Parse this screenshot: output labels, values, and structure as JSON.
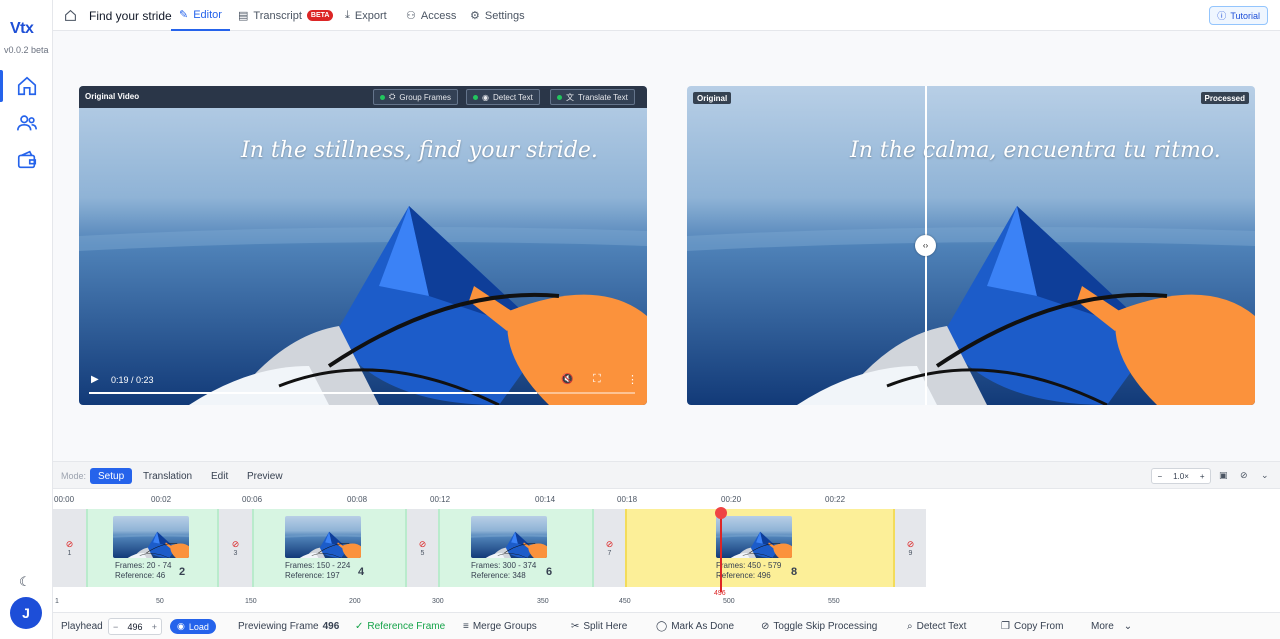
{
  "app": {
    "logo": "Vtx",
    "version": "v0.0.2 beta",
    "user_initial": "J"
  },
  "nav": {
    "project_title": "Find your stride",
    "tabs": [
      {
        "label": "Editor"
      },
      {
        "label": "Transcript"
      },
      {
        "label": "Export"
      },
      {
        "label": "Access"
      },
      {
        "label": "Settings"
      }
    ],
    "beta_badge": "BETA",
    "tutorial_label": "Tutorial"
  },
  "original_video": {
    "title": "Original Video",
    "buttons": [
      "Group Frames",
      "Detect Text",
      "Translate Text"
    ],
    "caption": "In the stillness, find your stride.",
    "time": "0:19 / 0:23",
    "progress": 0.82
  },
  "compare": {
    "left_label": "Original",
    "right_label": "Processed",
    "caption": "In the calma, encuentra tu ritmo."
  },
  "modebar": {
    "label": "Mode:",
    "tabs": [
      "Setup",
      "Translation",
      "Edit",
      "Preview"
    ],
    "zoom": "1.0×",
    "zoom_minus": "−",
    "zoom_plus": "+"
  },
  "timeline": {
    "time_labels": [
      "00:00",
      "00:02",
      "00:06",
      "00:08",
      "00:12",
      "00:14",
      "00:18",
      "00:20",
      "00:22"
    ],
    "skip_markers": [
      "1",
      "3",
      "5",
      "7",
      "9"
    ],
    "segments": [
      {
        "frames": "Frames: 20 - 74",
        "reference": "Reference: 46",
        "num": "2"
      },
      {
        "frames": "Frames: 150 - 224",
        "reference": "Reference: 197",
        "num": "4"
      },
      {
        "frames": "Frames: 300 - 374",
        "reference": "Reference: 348",
        "num": "6"
      },
      {
        "frames": "Frames: 450 - 579",
        "reference": "Reference: 496",
        "num": "8"
      }
    ],
    "frame_labels": [
      "1",
      "50",
      "150",
      "200",
      "300",
      "350",
      "450",
      "500",
      "550"
    ],
    "playhead_frame": "496"
  },
  "toolbar": {
    "playhead_label": "Playhead",
    "playhead_value": "496",
    "minus": "−",
    "plus": "+",
    "load_label": "Load",
    "previewing_label": "Previewing Frame",
    "previewing_value": "496",
    "reference_frame": "Reference Frame",
    "merge_groups": "Merge Groups",
    "split_here": "Split Here",
    "mark_done": "Mark As Done",
    "toggle_skip": "Toggle Skip Processing",
    "detect_text": "Detect Text",
    "copy_from": "Copy From",
    "more": "More"
  }
}
